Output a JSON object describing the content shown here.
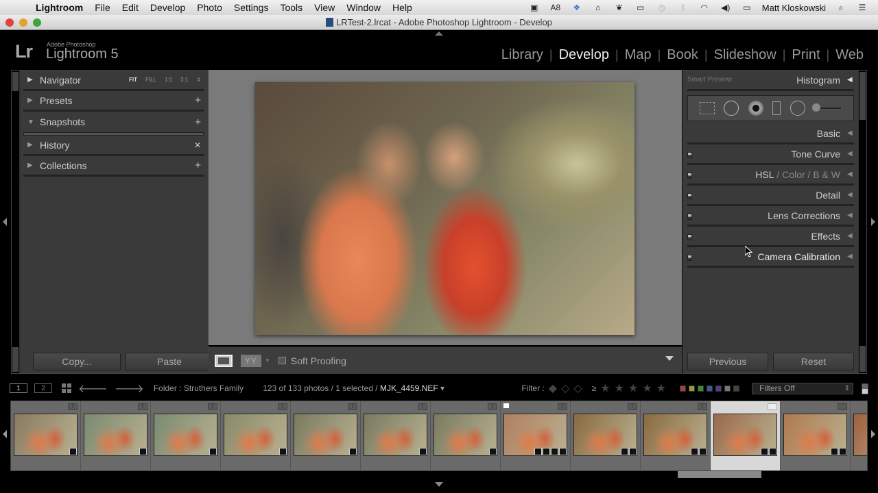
{
  "menubar": {
    "apple_icon": "apple-icon",
    "items": [
      "Lightroom",
      "File",
      "Edit",
      "Develop",
      "Photo",
      "Settings",
      "Tools",
      "View",
      "Window",
      "Help"
    ],
    "status": {
      "adobe_badge": "8",
      "user": "Matt Kloskowski"
    }
  },
  "window": {
    "title": "LRTest-2.lrcat - Adobe Photoshop Lightroom - Develop"
  },
  "identity": {
    "logo": "Lr",
    "brand_small": "Adobe Photoshop",
    "brand_name": "Lightroom 5"
  },
  "modules": [
    {
      "label": "Library",
      "active": false
    },
    {
      "label": "Develop",
      "active": true
    },
    {
      "label": "Map",
      "active": false
    },
    {
      "label": "Book",
      "active": false
    },
    {
      "label": "Slideshow",
      "active": false
    },
    {
      "label": "Print",
      "active": false
    },
    {
      "label": "Web",
      "active": false
    }
  ],
  "left_panel": {
    "navigator": {
      "label": "Navigator",
      "zoom_options": [
        "FIT",
        "FILL",
        "1:1",
        "3:1"
      ],
      "active_zoom": "FIT"
    },
    "panels": [
      {
        "label": "Presets",
        "action": "+"
      },
      {
        "label": "Snapshots",
        "action": "+"
      },
      {
        "label": "History",
        "action": "✕"
      },
      {
        "label": "Collections",
        "action": "+"
      }
    ],
    "buttons": {
      "copy": "Copy...",
      "paste": "Paste"
    }
  },
  "toolbar": {
    "soft_proofing_label": "Soft Proofing",
    "soft_proofing_checked": false,
    "compare_label": "YY"
  },
  "right_panel": {
    "smart_preview": "Smart Preview",
    "histogram": "Histogram",
    "panels": [
      {
        "label": "Basic",
        "toggle": false
      },
      {
        "label": "Tone Curve",
        "toggle": true
      },
      {
        "label": "HSL",
        "extra": [
          "Color",
          "B & W"
        ],
        "toggle": true
      },
      {
        "label": "Detail",
        "toggle": true
      },
      {
        "label": "Lens Corrections",
        "toggle": true
      },
      {
        "label": "Effects",
        "toggle": true
      },
      {
        "label": "Camera Calibration",
        "toggle": true
      }
    ],
    "buttons": {
      "previous": "Previous",
      "reset": "Reset"
    }
  },
  "filterbar": {
    "view1": "1",
    "view2": "2",
    "folder": "Folder : Struthers Family",
    "count": "123 of 133 photos / 1 selected / ",
    "filename": "MJK_4459.NEF",
    "filter_label": "Filter :",
    "rating_op": "≥",
    "color_labels": [
      "#a0443a",
      "#9a9a3a",
      "#3a8a3a",
      "#3a5a9a",
      "#5a3a8a",
      "#777777",
      "#444444"
    ],
    "filters_value": "Filters Off"
  },
  "filmstrip": {
    "thumbs": [
      {
        "badge": "!",
        "icons": 1,
        "selected": false,
        "flag": false,
        "tone": "#8a7a60"
      },
      {
        "badge": "!",
        "icons": 1,
        "selected": false,
        "flag": false,
        "tone": "#7a8a70"
      },
      {
        "badge": "!",
        "icons": 1,
        "selected": false,
        "flag": false,
        "tone": "#7a8a70"
      },
      {
        "badge": "!",
        "icons": 1,
        "selected": false,
        "flag": false,
        "tone": "#8a8a6a"
      },
      {
        "badge": "!",
        "icons": 1,
        "selected": false,
        "flag": false,
        "tone": "#7a7a60"
      },
      {
        "badge": "!",
        "icons": 1,
        "selected": false,
        "flag": false,
        "tone": "#7a7a60"
      },
      {
        "badge": "!",
        "icons": 1,
        "selected": false,
        "flag": false,
        "tone": "#7a7a60"
      },
      {
        "badge": "!",
        "icons": 4,
        "selected": false,
        "flag": true,
        "tone": "#b08060"
      },
      {
        "badge": "!",
        "icons": 2,
        "selected": false,
        "flag": false,
        "tone": "#8a6a40"
      },
      {
        "badge": "!",
        "icons": 2,
        "selected": false,
        "flag": false,
        "tone": "#8a6a40"
      },
      {
        "badge": "",
        "icons": 2,
        "selected": true,
        "flag": false,
        "tone": "#9a6a4a"
      },
      {
        "badge": "",
        "icons": 2,
        "selected": false,
        "flag": false,
        "tone": "#b07a50"
      },
      {
        "badge": "",
        "icons": 0,
        "selected": false,
        "flag": false,
        "tone": "#a06040"
      }
    ]
  }
}
